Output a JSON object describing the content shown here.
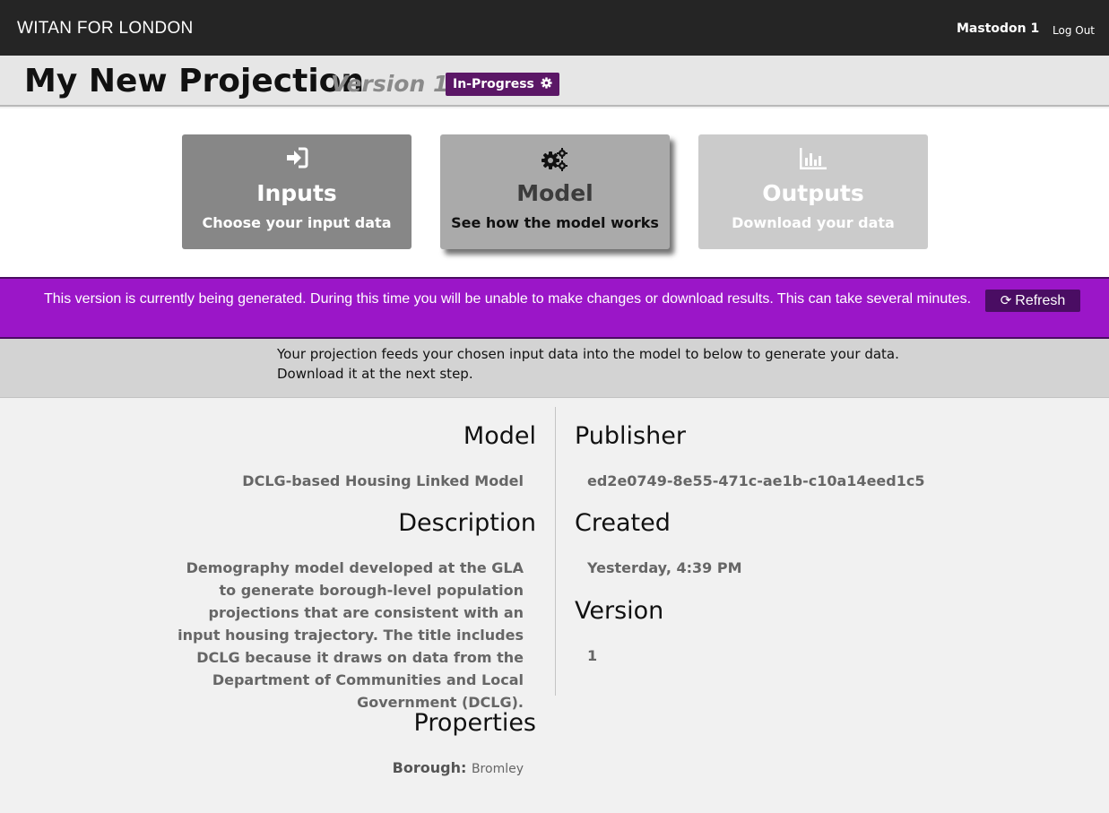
{
  "header": {
    "brand": "WITAN FOR LONDON",
    "user_name": "Mastodon 1",
    "logout_label": "Log Out"
  },
  "title_bar": {
    "title": "My New Projection",
    "version_label": "Version 1",
    "status_badge": "In-Progress",
    "status_icon": "gear-icon"
  },
  "nav_cards": [
    {
      "title": "Inputs",
      "subtitle": "Choose your input data",
      "icon": "sign-in-icon"
    },
    {
      "title": "Model",
      "subtitle": "See how the model works",
      "icon": "cogs-icon"
    },
    {
      "title": "Outputs",
      "subtitle": "Download your data",
      "icon": "bar-chart-icon"
    }
  ],
  "banner": {
    "message": "This version is currently being generated. During this time you will be unable to make changes or download results. This can take several minutes.",
    "refresh_label": "Refresh",
    "refresh_icon": "refresh-icon"
  },
  "info": {
    "line1": "Your projection feeds your chosen input data into the model to below to generate your data.",
    "line2": "Download it at the next step."
  },
  "details": {
    "model_heading": "Model",
    "model_value": "DCLG-based Housing Linked Model",
    "description_heading": "Description",
    "description_value": "Demography model developed at the GLA to generate borough-level population projections that are consistent with an input housing trajectory. The title includes DCLG because it draws on data from the Department of Communities and Local Government (DCLG).",
    "properties_heading": "Properties",
    "property_key": "Borough:",
    "property_value": "Bromley",
    "publisher_heading": "Publisher",
    "publisher_value": "ed2e0749-8e55-471c-ae1b-c10a14eed1c5",
    "created_heading": "Created",
    "created_value": "Yesterday, 4:39 PM",
    "version_heading": "Version",
    "version_value": "1"
  },
  "colors": {
    "topbar": "#252525",
    "badge": "#5b1766",
    "banner": "#9b16c8",
    "refresh_button": "#4a0d63"
  }
}
